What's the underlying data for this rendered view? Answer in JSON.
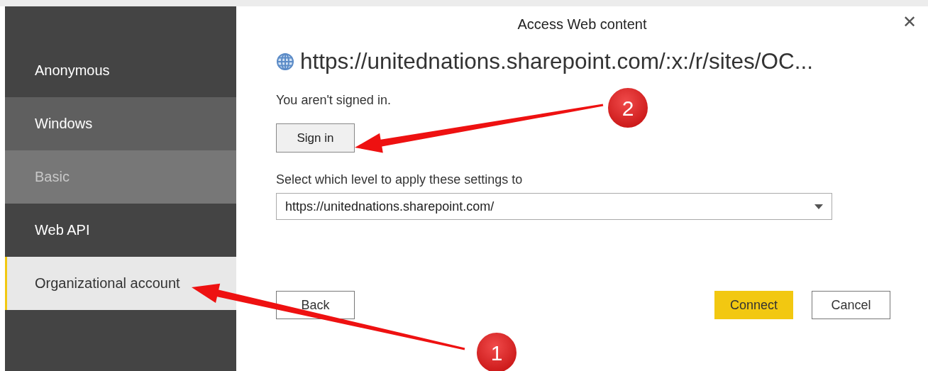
{
  "sidebar": {
    "items": [
      {
        "label": "Anonymous",
        "selected": false,
        "hovered": false,
        "disabled": false
      },
      {
        "label": "Windows",
        "selected": false,
        "hovered": true,
        "disabled": false
      },
      {
        "label": "Basic",
        "selected": false,
        "hovered": false,
        "disabled": true
      },
      {
        "label": "Web API",
        "selected": false,
        "hovered": false,
        "disabled": false
      },
      {
        "label": "Organizational account",
        "selected": true,
        "hovered": false,
        "disabled": false
      }
    ]
  },
  "dialog": {
    "title": "Access Web content",
    "close": "✕",
    "url": "https://unitednations.sharepoint.com/:x:/r/sites/OC...",
    "status": "You aren't signed in.",
    "sign_in_button": "Sign in",
    "level_label": "Select which level to apply these settings to",
    "level_select": {
      "value": "https://unitednations.sharepoint.com/"
    },
    "buttons": [
      {
        "label": "Back",
        "kind": "plain"
      },
      {
        "label": "Connect",
        "kind": "primary"
      },
      {
        "label": "Cancel",
        "kind": "plain"
      }
    ]
  },
  "annotations": [
    {
      "number": "1"
    },
    {
      "number": "2"
    }
  ]
}
